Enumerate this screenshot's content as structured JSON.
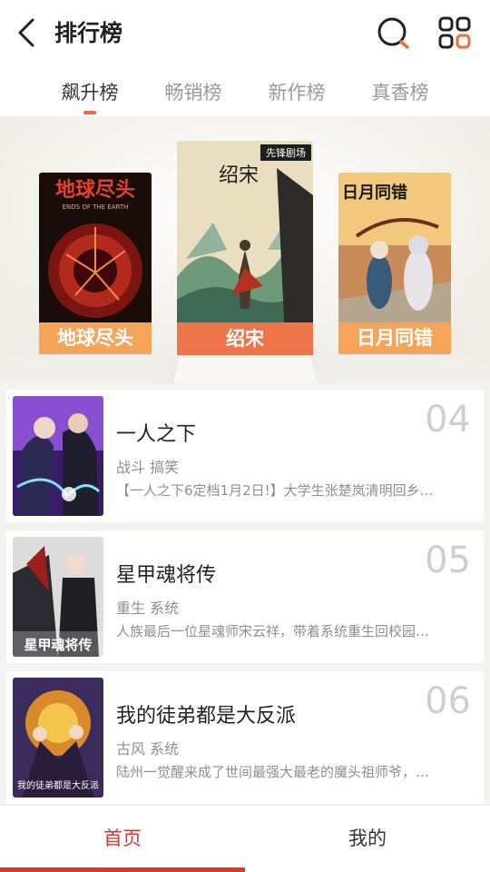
{
  "header": {
    "title": "排行榜",
    "back_icon": "chevron-left-icon",
    "search_icon": "search-icon",
    "grid_icon": "grid-icon"
  },
  "tabs": [
    {
      "label": "飙升榜",
      "active": true
    },
    {
      "label": "畅销榜",
      "active": false
    },
    {
      "label": "新作榜",
      "active": false
    },
    {
      "label": "真香榜",
      "active": false
    }
  ],
  "top3": [
    {
      "rank": 2,
      "title": "地球尽头",
      "cover_title": "地球尽头",
      "cover_subtitle": "ENDS OF THE EARTH"
    },
    {
      "rank": 1,
      "title": "绍宋",
      "cover_title": "绍宋",
      "cover_badge": "先锋剧场"
    },
    {
      "rank": 3,
      "title": "日月同错",
      "cover_title": "日月同错"
    }
  ],
  "list": [
    {
      "rank": "04",
      "title": "一人之下",
      "tags": "战斗 搞笑",
      "desc": "【一人之下6定档1月2日!】大学生张楚岚清明回乡…"
    },
    {
      "rank": "05",
      "title": "星甲魂将传",
      "tags": "重生 系统",
      "desc": "人族最后一位星魂师宋云祥，带着系统重生回校园…",
      "cover_title": "星甲魂将传"
    },
    {
      "rank": "06",
      "title": "我的徒弟都是大反派",
      "tags": "古风 系统",
      "desc": "陆州一觉醒来成了世间最强大最老的魔头祖师爷，…",
      "cover_title": "我的徒弟都是大反派"
    }
  ],
  "bottom_nav": [
    {
      "label": "首页",
      "active": true
    },
    {
      "label": "我的",
      "active": false
    }
  ],
  "colors": {
    "accent": "#e0352b",
    "tab_indicator": "#f06c3d",
    "gold_label": "#f6a45a",
    "center_label": "#ee7449"
  }
}
